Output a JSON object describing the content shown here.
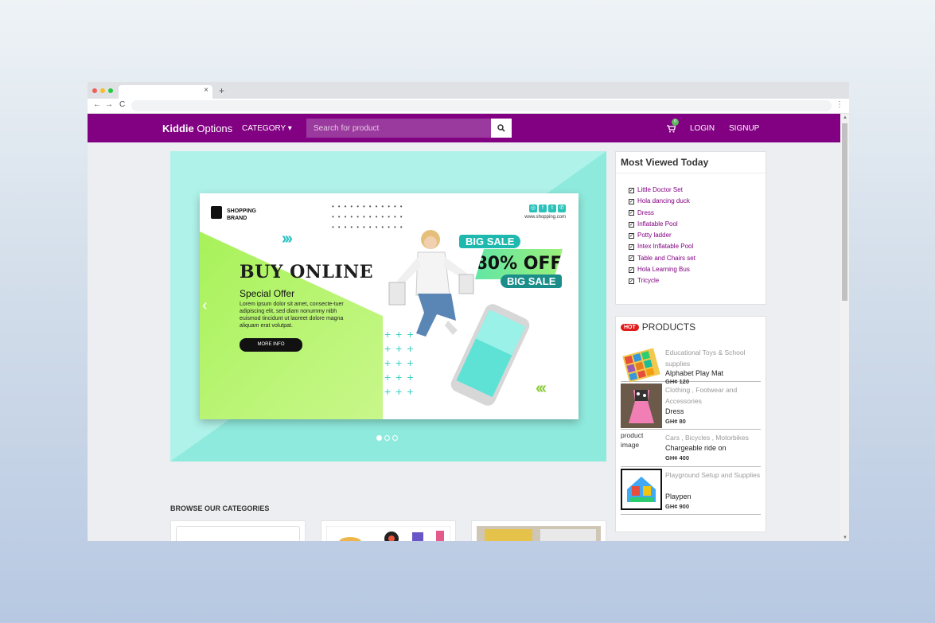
{
  "browser": {
    "tab_close": "×",
    "tab_new": "+",
    "back": "←",
    "forward": "→",
    "reload": "C",
    "menu": "⋮",
    "dot_colors": [
      "#ee5f57",
      "#f5bd2f",
      "#28c840"
    ]
  },
  "navbar": {
    "brand_bold": "Kiddie",
    "brand_rest": " Options",
    "category": "CATEGORY ▾",
    "search_placeholder": "Search for product",
    "cart_count": "0",
    "login": "LOGIN",
    "signup": "SIGNUP",
    "bg_color": "#820082"
  },
  "hero": {
    "shopping_brand_1": "SHOPPING",
    "shopping_brand_2": "BRAND",
    "site_url": "www.shopping.com",
    "buy_online": "BUY ONLINE",
    "special_offer": "Special Offer",
    "lorem": "Lorem ipsum dolor sit amet, consecte-tuer adipiscing elit, sed diam nonummy nibh euismod tincidunt ut laoreet dolore magna aliquam erat volutpat.",
    "more_info": "MORE INFO",
    "big_sale_top": "BIG SALE",
    "off_text": "80% OFF",
    "big_sale_bottom": "BIG SALE",
    "prev_arrow": "‹",
    "next_arrow": "›",
    "slide_count": 3,
    "active_slide": 1
  },
  "most_viewed": {
    "title": "Most Viewed Today",
    "items": [
      "Little Doctor Set",
      "Hola dancing duck",
      "Dress",
      "Inflatable Pool",
      "Potty ladder",
      "Intex Inflatable Pool",
      "Table and Chairs set",
      "Hola Learning Bus",
      "Tricycle"
    ]
  },
  "hot_products": {
    "badge": "HOT",
    "title": "PRODUCTS",
    "items": [
      {
        "category": "Educational Toys & School supplies",
        "name": "Alphabet Play Mat",
        "price": "GH¢ 120"
      },
      {
        "category": "Clothing , Footwear and Accessories",
        "name": "Dress",
        "price": "GH¢ 80"
      },
      {
        "category": "Cars , Bicycles , Motorbikes",
        "name": "Chargeable ride on",
        "price": "GH¢ 400",
        "broken_image_alt": "product image"
      },
      {
        "category": "Playground Setup and Supplies",
        "name": "Playpen",
        "price": "GH¢ 900"
      }
    ]
  },
  "browse": {
    "title": "BROWSE OUR CATEGORIES"
  }
}
